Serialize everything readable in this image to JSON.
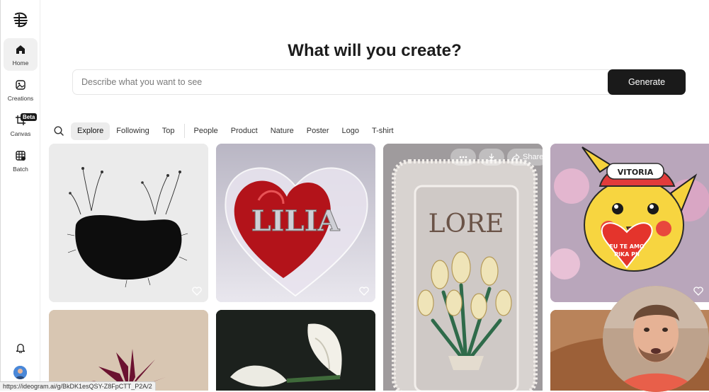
{
  "sidebar": {
    "items": [
      {
        "label": "Home",
        "icon": "home-icon"
      },
      {
        "label": "Creations",
        "icon": "image-icon"
      },
      {
        "label": "Canvas",
        "icon": "crop-icon"
      },
      {
        "label": "Batch",
        "icon": "grid-icon"
      }
    ],
    "beta_badge": "Beta"
  },
  "main": {
    "headline": "What will you create?",
    "search_placeholder": "Describe what you want to see",
    "generate_label": "Generate"
  },
  "filters": {
    "primary": [
      "Explore",
      "Following",
      "Top"
    ],
    "categories": [
      "People",
      "Product",
      "Nature",
      "Poster",
      "Logo",
      "T-shirt"
    ]
  },
  "gallery": {
    "card_actions": {
      "share": "Share"
    },
    "texts": {
      "lilia": "LILIA",
      "lore": "LORE",
      "vitoria": "VITORIA",
      "heart_line1": "EU TE AMO",
      "heart_line2": "PIKA PII"
    }
  },
  "status_url": "https://ideogram.ai/g/BkDK1esQSY-Z8FpCTT_P2A/2",
  "colors": {
    "accent": "#1a1a1a",
    "chip_bg": "#ececec"
  }
}
